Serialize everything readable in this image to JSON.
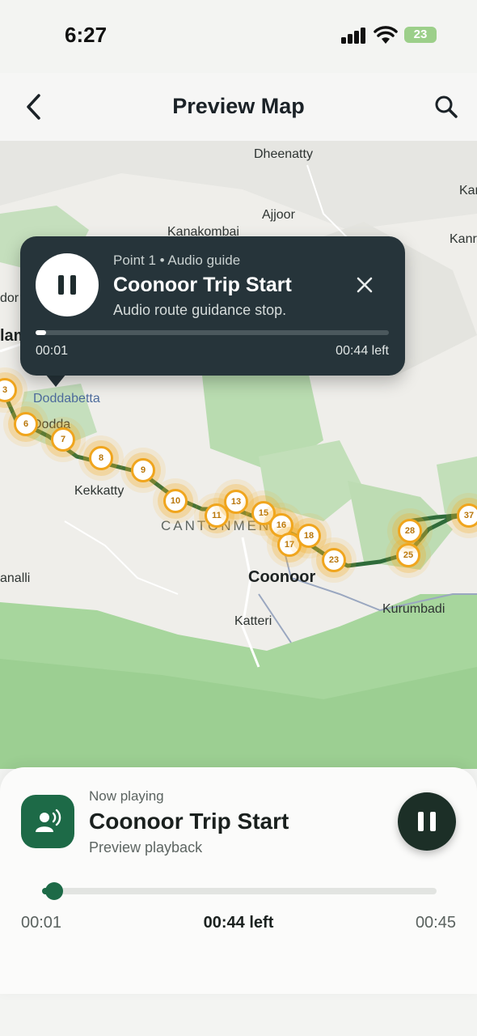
{
  "status": {
    "time": "6:27",
    "battery": "23"
  },
  "header": {
    "title": "Preview Map"
  },
  "map": {
    "places": [
      "Dheenatty",
      "Ajjoor",
      "Kanakombai",
      "Kar",
      "Kanr",
      "Doddabetta",
      "Kekkatty",
      "CANTONMEN",
      "Coonoor",
      "Katteri",
      "Kurumbadi",
      "analli",
      "Dodda",
      "lam",
      "dor"
    ],
    "markers": [
      "3",
      "6",
      "7",
      "8",
      "9",
      "10",
      "11",
      "13",
      "15",
      "16",
      "17",
      "18",
      "23",
      "25",
      "28",
      "37"
    ]
  },
  "popup": {
    "subtitle": "Point 1 • Audio guide",
    "title": "Coonoor Trip Start",
    "description": "Audio route guidance stop.",
    "current_time": "00:01",
    "time_left": "00:44 left",
    "progress": 0.03
  },
  "player": {
    "label": "Now playing",
    "title": "Coonoor Trip Start",
    "subtitle": "Preview playback",
    "current_time": "00:01",
    "time_left": "00:44 left",
    "total_time": "00:45",
    "progress": 0.03
  },
  "colors": {
    "accent": "#1d6a47",
    "marker": "#f0a51d",
    "popup_bg": "#26343a",
    "route": "#2f6b3a"
  }
}
